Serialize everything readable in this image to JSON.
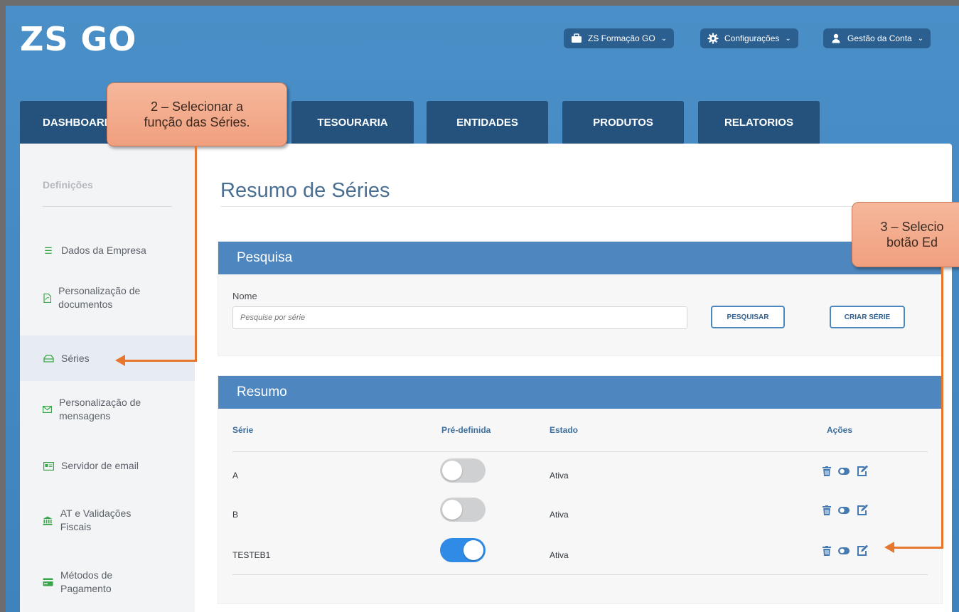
{
  "app": {
    "logo": "ZS GO"
  },
  "header": {
    "company": "ZS Formação GO",
    "settings": "Configurações",
    "account": "Gestão da Conta"
  },
  "tabs": [
    {
      "label": "DASHBOARD"
    },
    {
      "label": "TESOURARIA"
    },
    {
      "label": "ENTIDADES"
    },
    {
      "label": "PRODUTOS"
    },
    {
      "label": "RELATORIOS"
    }
  ],
  "sidebar": {
    "title": "Definições",
    "items": [
      {
        "label": "Dados da Empresa",
        "icon": "list-icon"
      },
      {
        "label": "Personalização de documentos",
        "icon": "pdf-icon"
      },
      {
        "label": "Séries",
        "icon": "stack-icon",
        "active": true
      },
      {
        "label": "Personalização de mensagens",
        "icon": "envelope-icon"
      },
      {
        "label": "Servidor de email",
        "icon": "id-card-icon"
      },
      {
        "label": "AT e Validações Fiscais",
        "icon": "bank-icon"
      },
      {
        "label": "Métodos de Pagamento",
        "icon": "credit-card-icon"
      }
    ]
  },
  "page": {
    "title": "Resumo de Séries"
  },
  "search": {
    "heading": "Pesquisa",
    "name_label": "Nome",
    "placeholder": "Pesquise por série",
    "search_button": "PESQUISAR",
    "create_button": "CRIAR SÉRIE"
  },
  "summary": {
    "heading": "Resumo",
    "columns": [
      "Série",
      "Pré-definida",
      "Estado",
      "Ações"
    ],
    "rows": [
      {
        "serie": "A",
        "default": false,
        "estado": "Ativa"
      },
      {
        "serie": "B",
        "default": false,
        "estado": "Ativa"
      },
      {
        "serie": "TESTEB1",
        "default": true,
        "estado": "Ativa"
      }
    ]
  },
  "callouts": {
    "step2_line1": "2 – Selecionar a",
    "step2_line2": "função das Séries.",
    "step3_line1": "3 – Selecio",
    "step3_line2": "botão Ed"
  },
  "colors": {
    "accent": "#4e87bf",
    "nav": "#24527d",
    "toggle_on": "#2f8be6",
    "toggle_off": "#cfd0d2",
    "callout": "#f3a987",
    "arrow": "#e7772f"
  }
}
